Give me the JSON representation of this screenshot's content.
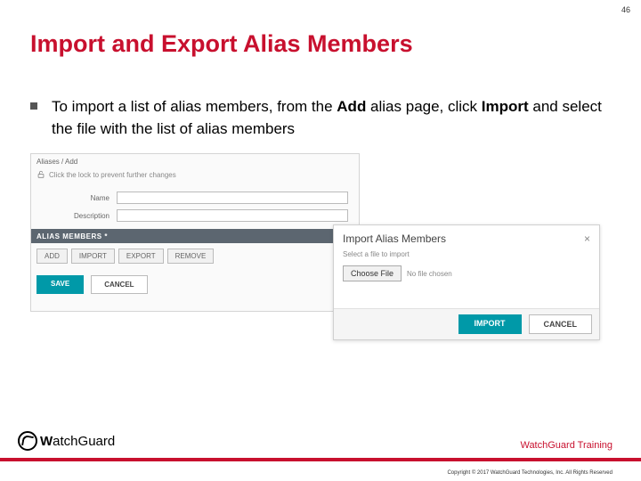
{
  "page_number": "46",
  "title": "Import and Export Alias Members",
  "bullet": {
    "pre": "To import a list of alias members, from the ",
    "bold1": "Add",
    "mid": " alias page, click ",
    "bold2": "Import",
    "post": " and select the file with the list of alias members"
  },
  "panel": {
    "crumb": "Aliases  /  Add",
    "lock_text": "Click the lock to prevent further changes",
    "name_label": "Name",
    "desc_label": "Description",
    "section": "ALIAS MEMBERS *",
    "tabs": {
      "add": "ADD",
      "import": "IMPORT",
      "export": "EXPORT",
      "remove": "REMOVE"
    },
    "save": "SAVE",
    "cancel": "CANCEL"
  },
  "modal": {
    "title": "Import Alias Members",
    "close": "×",
    "subtitle": "Select a file to import",
    "choose": "Choose File",
    "nofile": "No file chosen",
    "import": "IMPORT",
    "cancel": "CANCEL"
  },
  "footer": {
    "brand_w": "W",
    "brand_rest": "atchGuard",
    "training": "WatchGuard Training",
    "copyright": "Copyright © 2017 WatchGuard Technologies, Inc. All Rights Reserved"
  }
}
